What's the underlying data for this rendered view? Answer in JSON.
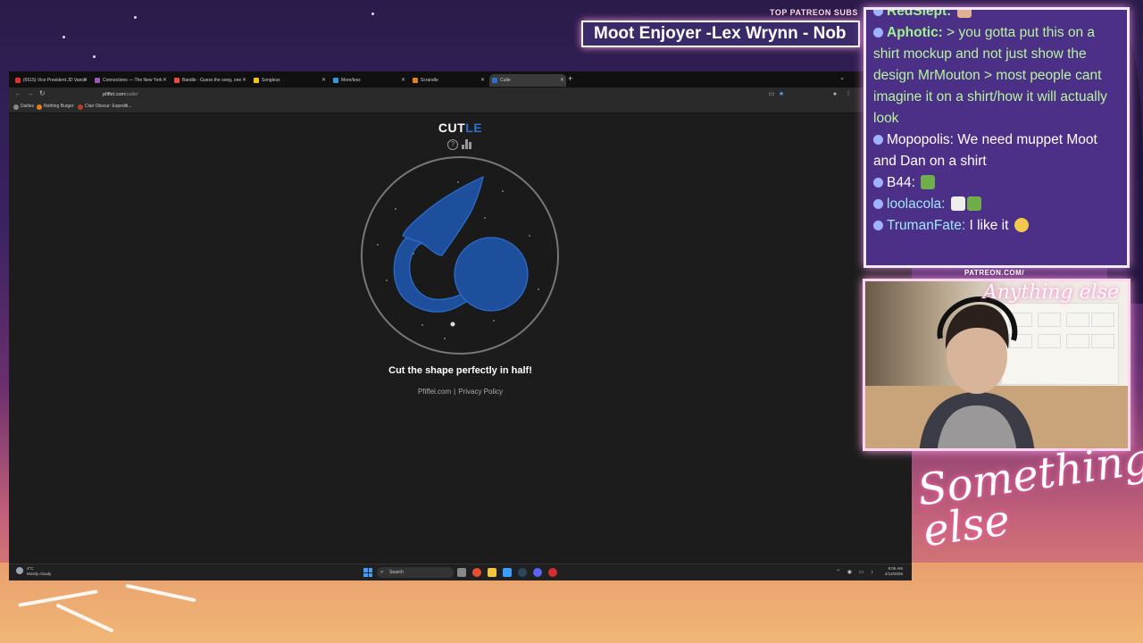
{
  "overlay": {
    "sub_label": "TOP PATREON SUBS",
    "sub_ticker": "Moot Enjoyer -Lex Wrynn -  Nob",
    "cam_label": "PATREON.COM/",
    "cam_logo": "Anything else",
    "brand_script": "Something else"
  },
  "browser": {
    "tabs": [
      {
        "label": "(6515) Vice President JD Vance",
        "color": "#e03030"
      },
      {
        "label": "Connections — The New York",
        "color": "#9b59b6"
      },
      {
        "label": "Bandle - Guess the song, one",
        "color": "#e74c3c"
      },
      {
        "label": "Songless",
        "color": "#f1c40f"
      },
      {
        "label": "More/less",
        "color": "#3498db"
      },
      {
        "label": "Scrandle",
        "color": "#e67e22"
      },
      {
        "label": "Cutle",
        "color": "#2d6fcf",
        "active": true
      }
    ],
    "url_domain": "pfiffel.com",
    "url_path": "/cutle/",
    "bookmarks": [
      {
        "label": "Dailies",
        "color": "#888888"
      },
      {
        "label": "Nothing Burger",
        "color": "#e67e22"
      },
      {
        "label": "Clair Obscur: Expediti...",
        "color": "#c0392b"
      }
    ]
  },
  "page": {
    "title_main": "CUT",
    "title_accent": "LE",
    "instructions": "Cut the shape perfectly in half!",
    "footer_site": "Pfiffel.com",
    "footer_sep": "|",
    "footer_privacy": "Privacy Policy",
    "accent_color": "#2d6fcf"
  },
  "taskbar": {
    "weather_temp": "4°C",
    "weather_desc": "Mostly cloudy",
    "search": "Search",
    "time": "9:05 AM",
    "date": "4/12/2026"
  },
  "chat": [
    {
      "user": "RedSlept:",
      "text": "",
      "user_class": "user-green"
    },
    {
      "user": "Aphotic:",
      "text": "> you gotta put this on a shirt mockup and not just show the design MrMouton > most people cant imagine it on a shirt/how it will actually look",
      "user_class": "user-green",
      "text_class": "text-green"
    },
    {
      "user": "Mopopolis:",
      "text": "We need muppet Moot and Dan on a shirt",
      "user_class": "user-white",
      "text_class": "user-white"
    },
    {
      "user": "B44:",
      "text": "",
      "user_class": "user-white"
    },
    {
      "user": "loolacola:",
      "text": "",
      "user_class": "user-teal"
    },
    {
      "user": "TrumanFate:",
      "text": "I like it",
      "user_class": "user-teal",
      "text_class": "user-white"
    }
  ]
}
